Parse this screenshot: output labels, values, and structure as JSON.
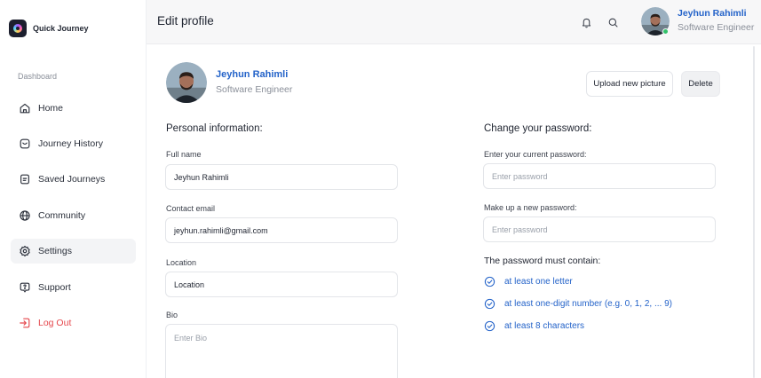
{
  "app": {
    "name": "Quick Journey"
  },
  "sidebar": {
    "section_label": "Dashboard",
    "items": [
      {
        "label": "Home",
        "icon": "home-icon"
      },
      {
        "label": "Journey History",
        "icon": "history-icon"
      },
      {
        "label": "Saved Journeys",
        "icon": "bookmark-icon"
      },
      {
        "label": "Community",
        "icon": "globe-icon"
      },
      {
        "label": "Settings",
        "icon": "gear-icon"
      },
      {
        "label": "Support",
        "icon": "help-icon"
      },
      {
        "label": "Log Out",
        "icon": "logout-icon"
      }
    ],
    "active_item": "Settings"
  },
  "header": {
    "title": "Edit profile",
    "user": {
      "name": "Jeyhun Rahimli",
      "role": "Software Engineer",
      "status": "online"
    }
  },
  "profile": {
    "name": "Jeyhun Rahimli",
    "role": "Software Engineer",
    "upload_label": "Upload new picture",
    "delete_label": "Delete"
  },
  "personal": {
    "title": "Personal information:",
    "full_name": {
      "label": "Full name",
      "value": "Jeyhun Rahimli"
    },
    "email": {
      "label": "Contact email",
      "value": "jeyhun.rahimli@gmail.com"
    },
    "location": {
      "label": "Location",
      "value": "Location"
    },
    "bio": {
      "label": "Bio",
      "placeholder": "Enter Bio"
    }
  },
  "password": {
    "title": "Change your password:",
    "current": {
      "label": "Enter your current password:",
      "placeholder": "Enter password"
    },
    "new": {
      "label": "Make up a new password:",
      "placeholder": "Enter password"
    },
    "requirements_title": "The password must contain:",
    "requirements": [
      "at least one letter",
      "at least one-digit number (e.g. 0, 1, 2, ... 9)",
      "at least 8 characters"
    ]
  },
  "colors": {
    "accent": "#2463c9",
    "danger": "#e5484d",
    "online": "#33c26b"
  }
}
